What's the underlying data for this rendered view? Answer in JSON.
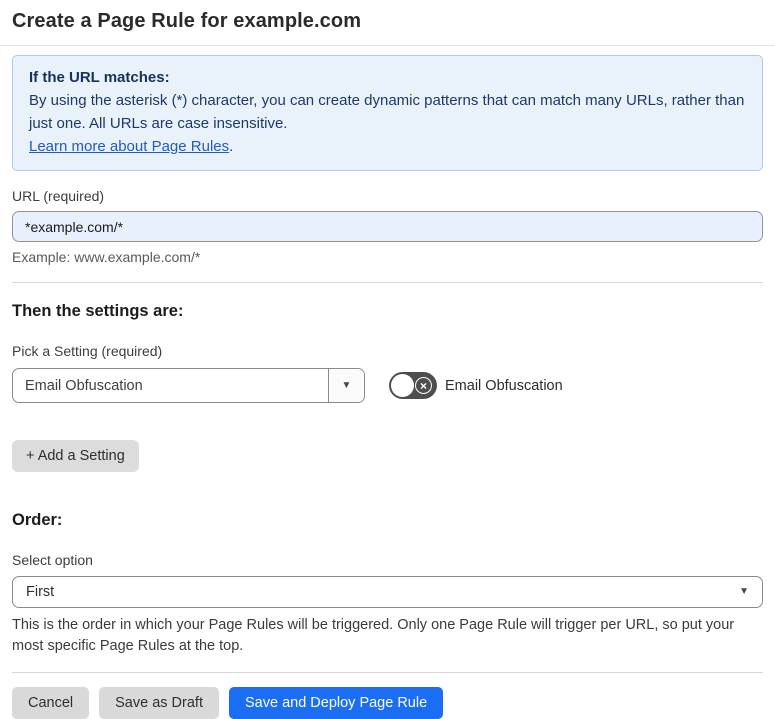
{
  "page": {
    "title": "Create a Page Rule for example.com"
  },
  "info_box": {
    "heading": "If the URL matches:",
    "body": "By using the asterisk (*) character, you can create dynamic patterns that can match many URLs, rather than just one. All URLs are case insensitive.",
    "link_label": "Learn more about Page Rules",
    "link_suffix": "."
  },
  "url_field": {
    "label": "URL (required)",
    "value": "*example.com/*",
    "example": "Example: www.example.com/*"
  },
  "settings": {
    "heading": "Then the settings are:",
    "picker_label": "Pick a Setting (required)",
    "picker_value": "Email Obfuscation",
    "toggle_label": "Email Obfuscation",
    "toggle_state": "off",
    "add_button": "+ Add a Setting"
  },
  "order": {
    "heading": "Order:",
    "select_label": "Select option",
    "select_value": "First",
    "help_text": "This is the order in which your Page Rules will be triggered. Only one Page Rule will trigger per URL, so put your most specific Page Rules at the top."
  },
  "footer": {
    "cancel": "Cancel",
    "save_draft": "Save as Draft",
    "deploy": "Save and Deploy Page Rule"
  },
  "icons": {
    "caret_down": "▼",
    "toggle_x": "×"
  },
  "colors": {
    "info_bg": "#e9f2fb",
    "info_border": "#aecbe8",
    "info_text": "#1c3a66",
    "link_blue": "#1f5ac6",
    "autofill_input_bg": "#e8effd",
    "primary_button_blue": "#1b6ef3",
    "gray_button_bg": "#d9d9d9",
    "toggle_off_bg": "#4e4e4e",
    "divider": "#d8d8d8"
  }
}
